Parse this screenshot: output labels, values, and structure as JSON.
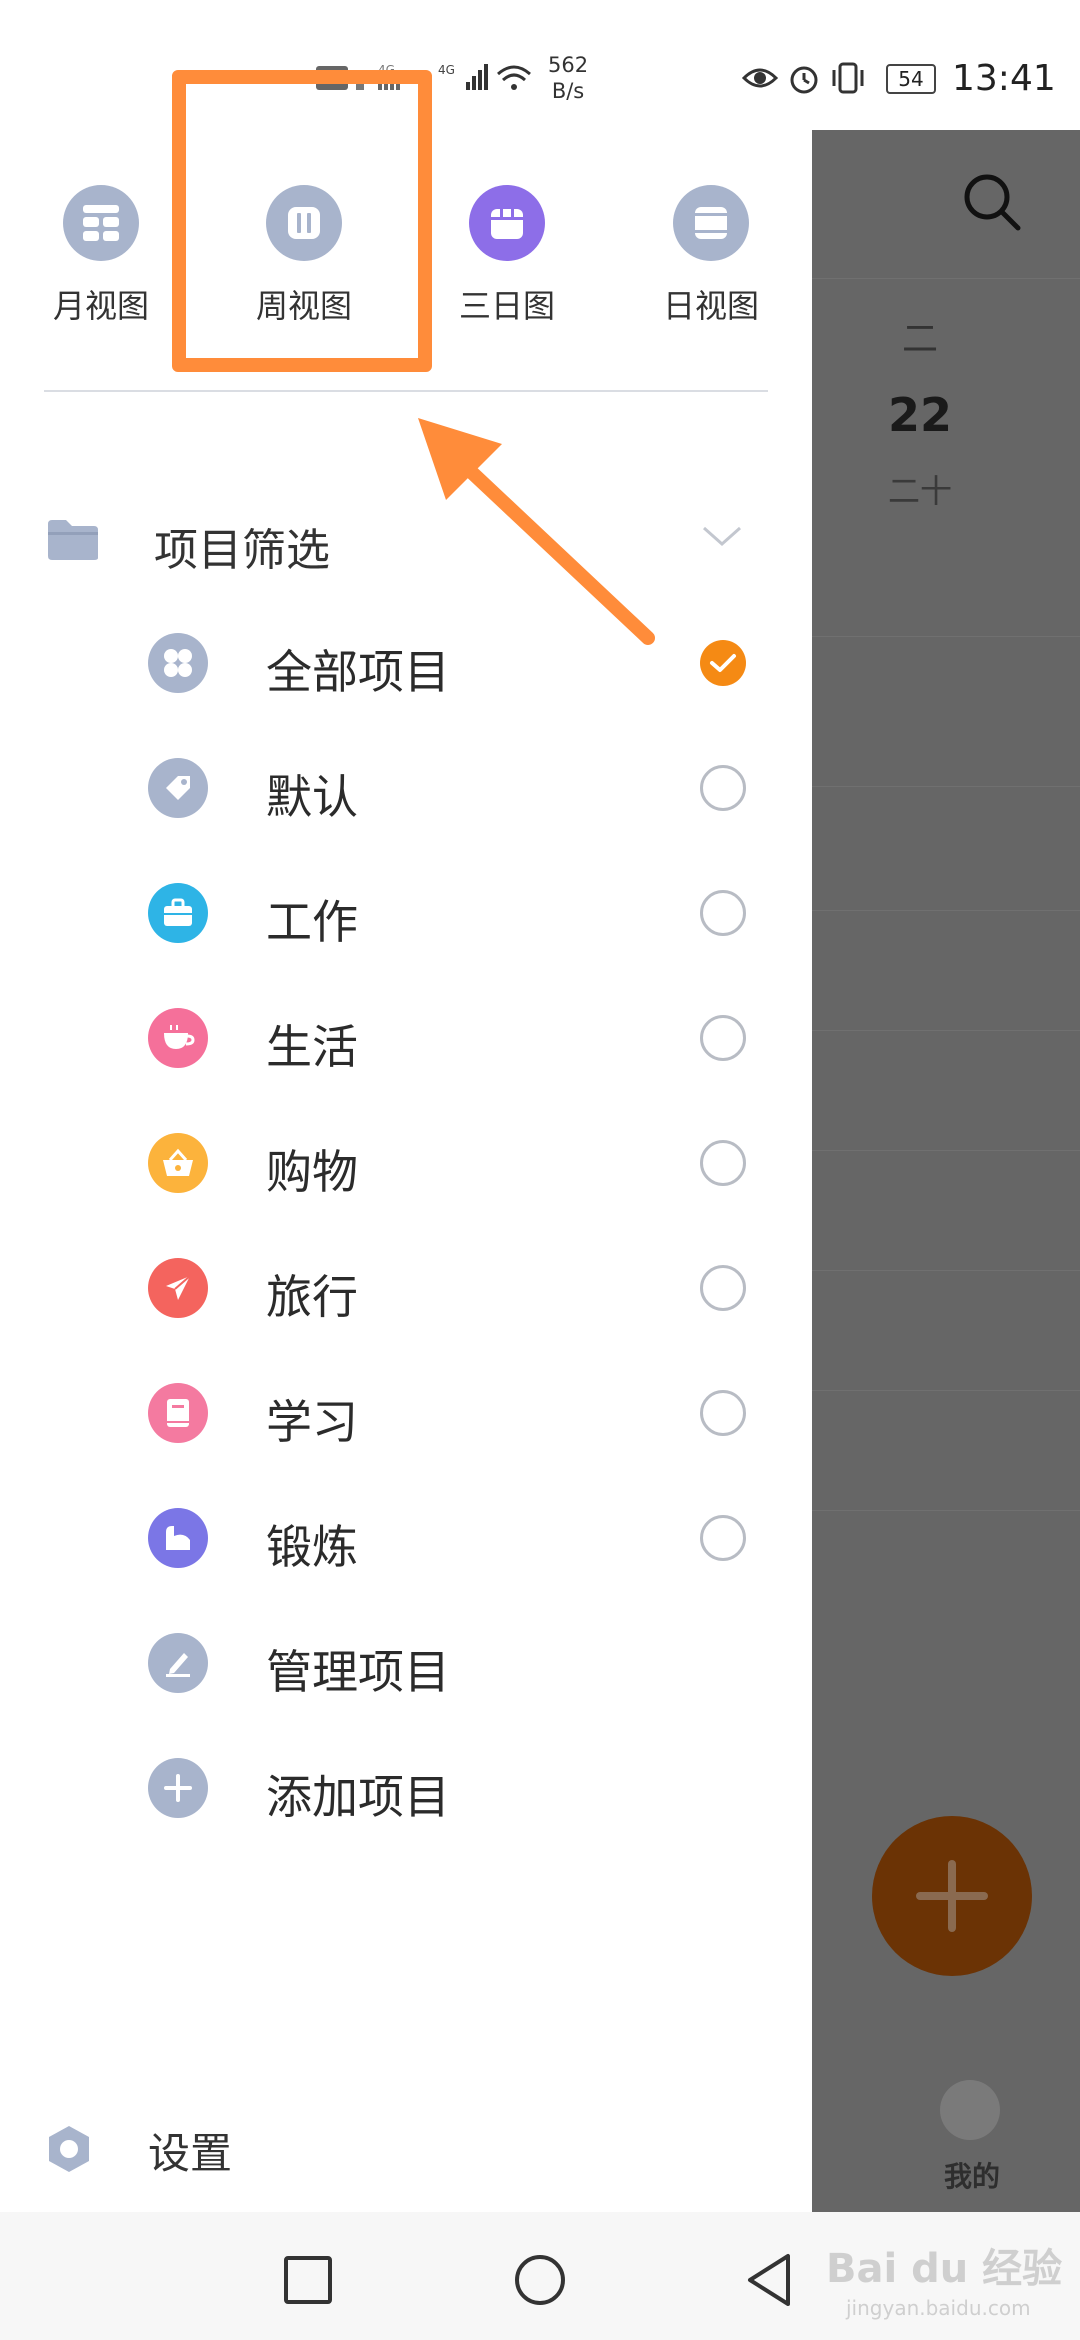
{
  "status_bar": {
    "network_speed_value": "562",
    "network_speed_unit": "B/s",
    "battery_level": "54",
    "time": "13:41"
  },
  "view_tabs": [
    {
      "label": "月视图",
      "icon": "month-grid-icon",
      "color": "#a8b4cc"
    },
    {
      "label": "周视图",
      "icon": "week-columns-icon",
      "color": "#a8b4cc"
    },
    {
      "label": "三日图",
      "icon": "three-day-calendar-icon",
      "color": "#8d6ee8"
    },
    {
      "label": "日视图",
      "icon": "day-view-icon",
      "color": "#a8b4cc"
    }
  ],
  "project_filter": {
    "title": "项目筛选",
    "items": [
      {
        "label": "全部项目",
        "icon": "four-petal-icon",
        "color": "#a8b4cc",
        "checked": true
      },
      {
        "label": "默认",
        "icon": "tag-icon",
        "color": "#a8b4cc",
        "checked": false
      },
      {
        "label": "工作",
        "icon": "briefcase-icon",
        "color": "#2eb4e6",
        "checked": false
      },
      {
        "label": "生活",
        "icon": "coffee-cup-icon",
        "color": "#f5709a",
        "checked": false
      },
      {
        "label": "购物",
        "icon": "shopping-basket-icon",
        "color": "#fcb33c",
        "checked": false
      },
      {
        "label": "旅行",
        "icon": "airplane-icon",
        "color": "#f4645e",
        "checked": false
      },
      {
        "label": "学习",
        "icon": "book-icon",
        "color": "#f47aa0",
        "checked": false
      },
      {
        "label": "锻炼",
        "icon": "muscle-arm-icon",
        "color": "#7b76e6",
        "checked": false
      }
    ],
    "actions": [
      {
        "label": "管理项目",
        "icon": "edit-pencil-icon",
        "color": "#a8b4cc"
      },
      {
        "label": "添加项目",
        "icon": "plus-icon",
        "color": "#a8b4cc"
      }
    ]
  },
  "settings": {
    "label": "设置",
    "icon": "gear-icon",
    "color": "#a8b4cc"
  },
  "background_calendar": {
    "weekday": "二",
    "day": "22",
    "lunar": "二十",
    "bottom_tab": "我的"
  },
  "annotation_color": "#ff8c3a",
  "watermark": {
    "main": "Bai du 经验",
    "sub": "jingyan.baidu.com"
  }
}
